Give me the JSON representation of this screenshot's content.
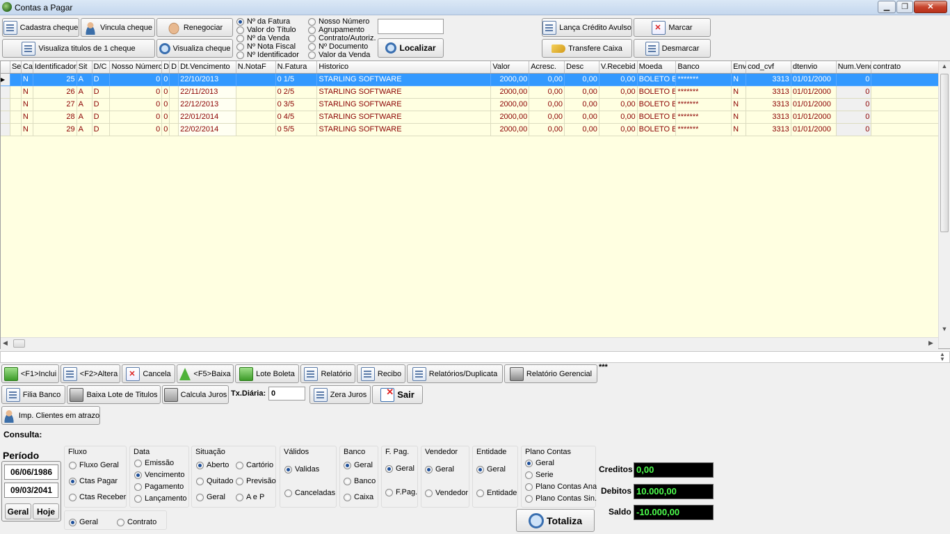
{
  "window": {
    "title": "Contas a Pagar",
    "minimize": "▁",
    "restore": "❐",
    "close": "✕"
  },
  "toolbar": {
    "cadastra_cheque": "Cadastra cheque",
    "vincula_cheque": "Vincula cheque",
    "renegociar": "Renegociar",
    "visualiza_titulos": "Visualiza titulos de 1 cheque",
    "visualiza_cheque": "Visualiza cheque",
    "localizar": "Localizar",
    "lanca_credito": "Lança Crédito Avulso",
    "marcar": "Marcar",
    "transfere_caixa": "Transfere Caixa",
    "desmarcar": "Desmarcar"
  },
  "search": {
    "options_col1": [
      "Nº da Fatura",
      "Valor do Título",
      "Nº da Venda",
      "Nº Nota Fiscal",
      "Nº Identificador"
    ],
    "options_col2": [
      "Nosso Número",
      "Agrupamento",
      "Contrato/Autoriz.",
      "Nº Documento",
      "Valor da Venda"
    ],
    "selected": "Nº da Fatura",
    "value": ""
  },
  "grid": {
    "columns": [
      "Se",
      "Ca",
      "Identificador",
      "Sit",
      "D/C",
      "Nosso Número",
      "D",
      "D",
      "Dt.Vencimento",
      "N.NotaF",
      "N.Fatura",
      "Historico",
      "Valor",
      "Acresc.",
      "Desc",
      "V.Recebid",
      "Moeda",
      "Banco",
      "Env",
      "cod_cvf",
      "dtenvio",
      "Num.Vend",
      "contrato"
    ],
    "rows": [
      {
        "ca": "N",
        "id": "25",
        "sit": "A",
        "dc": "D",
        "nosso": "0",
        "d1": "0",
        "venc": "22/10/2013",
        "nota": "",
        "fatura": "0 1/5",
        "hist": "STARLING SOFTWARE",
        "valor": "2000,00",
        "acresc": "0,00",
        "desc": "0,00",
        "receb": "0,00",
        "moeda": "BOLETO B",
        "banco": "*******",
        "env": "N",
        "cvf": "3313",
        "dtenvio": "01/01/2000",
        "numvend": "0",
        "contrato": ""
      },
      {
        "ca": "N",
        "id": "26",
        "sit": "A",
        "dc": "D",
        "nosso": "0",
        "d1": "0",
        "venc": "22/11/2013",
        "nota": "",
        "fatura": "0 2/5",
        "hist": "STARLING SOFTWARE",
        "valor": "2000,00",
        "acresc": "0,00",
        "desc": "0,00",
        "receb": "0,00",
        "moeda": "BOLETO B",
        "banco": "*******",
        "env": "N",
        "cvf": "3313",
        "dtenvio": "01/01/2000",
        "numvend": "0",
        "contrato": ""
      },
      {
        "ca": "N",
        "id": "27",
        "sit": "A",
        "dc": "D",
        "nosso": "0",
        "d1": "0",
        "venc": "22/12/2013",
        "nota": "",
        "fatura": "0 3/5",
        "hist": "STARLING SOFTWARE",
        "valor": "2000,00",
        "acresc": "0,00",
        "desc": "0,00",
        "receb": "0,00",
        "moeda": "BOLETO B",
        "banco": "*******",
        "env": "N",
        "cvf": "3313",
        "dtenvio": "01/01/2000",
        "numvend": "0",
        "contrato": ""
      },
      {
        "ca": "N",
        "id": "28",
        "sit": "A",
        "dc": "D",
        "nosso": "0",
        "d1": "0",
        "venc": "22/01/2014",
        "nota": "",
        "fatura": "0 4/5",
        "hist": "STARLING SOFTWARE",
        "valor": "2000,00",
        "acresc": "0,00",
        "desc": "0,00",
        "receb": "0,00",
        "moeda": "BOLETO B",
        "banco": "*******",
        "env": "N",
        "cvf": "3313",
        "dtenvio": "01/01/2000",
        "numvend": "0",
        "contrato": ""
      },
      {
        "ca": "N",
        "id": "29",
        "sit": "A",
        "dc": "D",
        "nosso": "0",
        "d1": "0",
        "venc": "22/02/2014",
        "nota": "",
        "fatura": "0 5/5",
        "hist": "STARLING SOFTWARE",
        "valor": "2000,00",
        "acresc": "0,00",
        "desc": "0,00",
        "receb": "0,00",
        "moeda": "BOLETO B",
        "banco": "*******",
        "env": "N",
        "cvf": "3313",
        "dtenvio": "01/01/2000",
        "numvend": "0",
        "contrato": ""
      }
    ]
  },
  "actions": {
    "incluir": "<F1>Inclui",
    "alterar": "<F2>Altera",
    "cancela": "Cancela",
    "baixa": "<F5>Baixa",
    "lote_boleta": "Lote Boleta",
    "relatorio": "Relatório",
    "recibo": "Recibo",
    "relatorios_duplicata": "Relatórios/Duplicata",
    "relatorio_gerencial": "Relatório Gerencial",
    "extra": "***",
    "filia_banco": "Filia Banco",
    "baixa_lote": "Baixa Lote de Titulos",
    "calcula_juros": "Calcula Juros",
    "tx_diaria_label": "Tx.Diária:",
    "tx_diaria_value": "0",
    "zera_juros": "Zera Juros",
    "sair": "Sair",
    "imp_clientes": "Imp. Clientes em atrazo"
  },
  "consulta": {
    "label": "Consulta:",
    "periodo": "Período",
    "data_inicio": "06/06/1986",
    "data_fim": "09/03/2041",
    "geral_btn": "Geral",
    "hoje_btn": "Hoje",
    "fluxo": {
      "title": "Fluxo",
      "options": [
        "Fluxo Geral",
        "Ctas Pagar",
        "Ctas Receber"
      ]
    },
    "data": {
      "title": "Data",
      "options": [
        "Emissão",
        "Vencimento",
        "Pagamento",
        "Lançamento"
      ]
    },
    "situacao": {
      "title": "Situação",
      "options": [
        "Aberto",
        "Cartório",
        "Quitado",
        "Previsão",
        "Geral",
        "A e P"
      ]
    },
    "validos": {
      "title": "Válidos",
      "options": [
        "Validas",
        "Canceladas"
      ]
    },
    "banco": {
      "title": "Banco",
      "options": [
        "Geral",
        "Banco",
        "Caixa"
      ]
    },
    "fpag": {
      "title": "F. Pag.",
      "options": [
        "Geral",
        "F.Pag."
      ]
    },
    "vendedor": {
      "title": "Vendedor",
      "options": [
        "Geral",
        "Vendedor"
      ]
    },
    "entidade": {
      "title": "Entidade",
      "options": [
        "Geral",
        "Entidade"
      ]
    },
    "plano": {
      "title": "Plano Contas",
      "options": [
        "Geral",
        "Serie",
        "Plano Contas Ana",
        "Plano Contas Sin."
      ]
    },
    "tipo": {
      "options": [
        "Geral",
        "Contrato"
      ]
    },
    "totaliza": "Totaliza"
  },
  "totais": {
    "creditos_label": "Creditos",
    "creditos": "0,00",
    "debitos_label": "Debitos",
    "debitos": "10.000,00",
    "saldo_label": "Saldo",
    "saldo": "-10.000,00"
  }
}
